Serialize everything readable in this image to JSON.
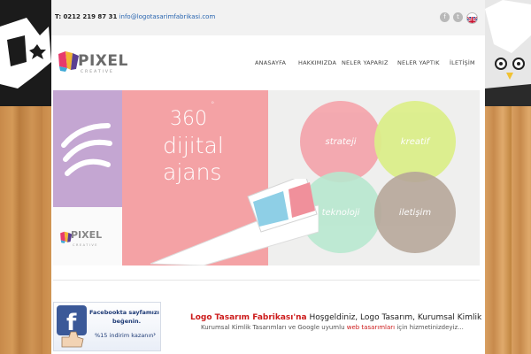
{
  "topbar": {
    "phone_label": "T:",
    "phone": "0212 219 87 31",
    "email": "info@logotasarimfabrikasi.com",
    "social": [
      {
        "name": "facebook",
        "glyph": "f"
      },
      {
        "name": "twitter",
        "glyph": "t"
      }
    ]
  },
  "logo": {
    "wordmark": "PIXEL",
    "tagline": "CREATIVE"
  },
  "nav": {
    "items": [
      "ANASAYFA",
      "HAKKIMIZDA",
      "NELER YAPARIZ",
      "NELER YAPTIK",
      "İLETİŞİM"
    ]
  },
  "slider": {
    "degree": "360",
    "degree_mark": "°",
    "line2": "dijital",
    "line3": "ajans",
    "mini_logo": "PIXEL",
    "mini_tagline": "CREATIVE",
    "circles": [
      {
        "label": "strateji",
        "color": "#f4a6ad"
      },
      {
        "label": "kreatif",
        "color": "#dcee8a"
      },
      {
        "label": "teknoloji",
        "color": "#b8e8cf"
      },
      {
        "label": "iletişim",
        "color": "#b7a79a"
      }
    ]
  },
  "facebook_box": {
    "line1": "Facebookta sayfamızı",
    "line2": "beğenin.",
    "line3": "%15 indirim kazanın",
    "arrow": "›"
  },
  "welcome": {
    "brand": "Logo Tasarım Fabrikası'na",
    "rest": " Hoşgeldiniz, Logo Tasarım, Kurumsal Kimlik"
  },
  "subtext": {
    "before": "Kurumsal Kimlik Tasarımları ve Google uyumlu ",
    "highlight": "web tasarımları",
    "after": " için hizmetinizdeyiz..."
  }
}
